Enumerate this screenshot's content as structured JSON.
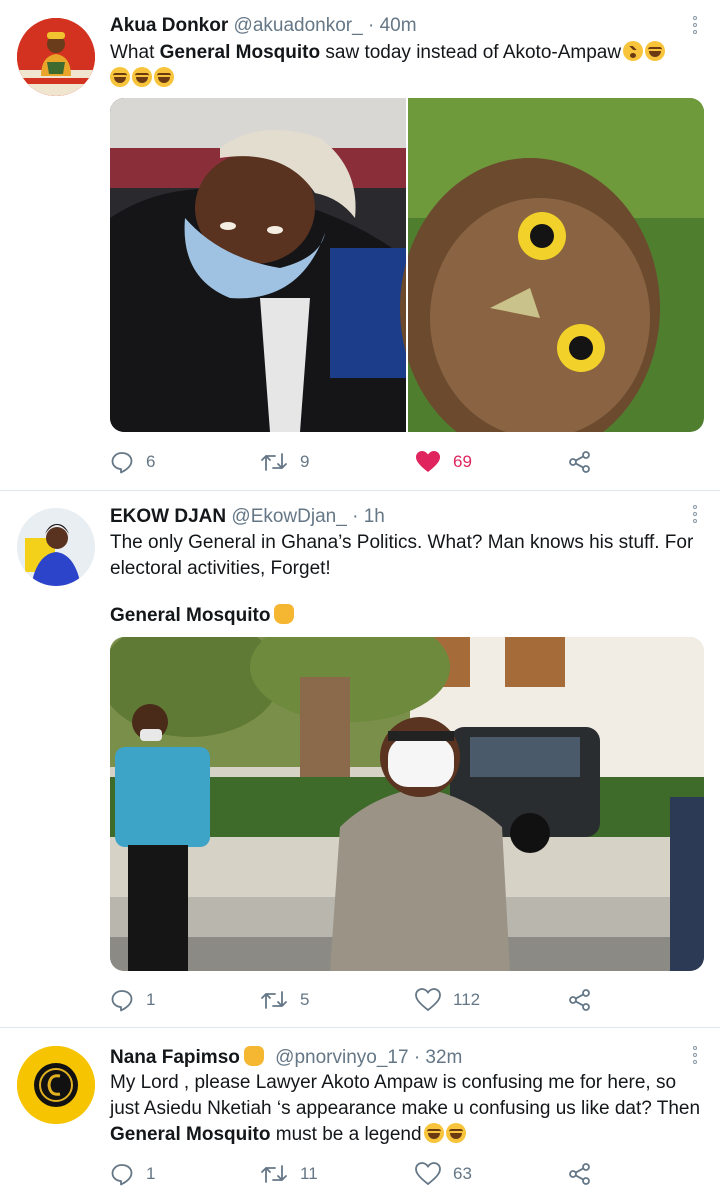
{
  "tweets": [
    {
      "name": "Akua Donkor",
      "handle": "@akuadonkor_",
      "time": "· 40m",
      "text_prefix": "What ",
      "text_bold": "General Mosquito",
      "text_suffix": " saw today instead of   Akoto-Ampaw",
      "emojis": [
        "dizzy-face",
        "tears-of-joy",
        "tears-of-joy",
        "tears-of-joy",
        "tears-of-joy"
      ],
      "replies": "6",
      "retweets": "9",
      "likes": "69",
      "liked": true
    },
    {
      "name": "EKOW DJAN",
      "handle": "@EkowDjan_",
      "time": "· 1h",
      "text": "The only General in Ghana’s Politics. What? Man knows his stuff. For electoral activities, Forget!",
      "text_bold": "General Mosquito",
      "emojis": [
        "raised-fist"
      ],
      "replies": "1",
      "retweets": "5",
      "likes": "112",
      "liked": false
    },
    {
      "name": "Nana Fapimso",
      "handle": "@pnorvinyo_17",
      "time": "· 32m",
      "text_prefix": "My Lord , please Lawyer Akoto Ampaw is confusing me for here, so just Asiedu Nketiah ‘s appearance make u confusing us like dat? Then ",
      "text_bold": "General Mosquito",
      "text_suffix": " must be a legend",
      "emojis": [
        "raised-fist",
        "tears-of-joy",
        "tears-of-joy"
      ],
      "replies": "1",
      "retweets": "11",
      "likes": "63",
      "liked": false
    }
  ],
  "colors": {
    "like_active": "#e0245e",
    "muted": "#657786",
    "divider": "#e1e8ed"
  },
  "icons": {
    "reply": "reply-icon",
    "retweet": "retweet-icon",
    "like": "heart-icon",
    "share": "share-icon",
    "more": "more-vertical-icon"
  }
}
